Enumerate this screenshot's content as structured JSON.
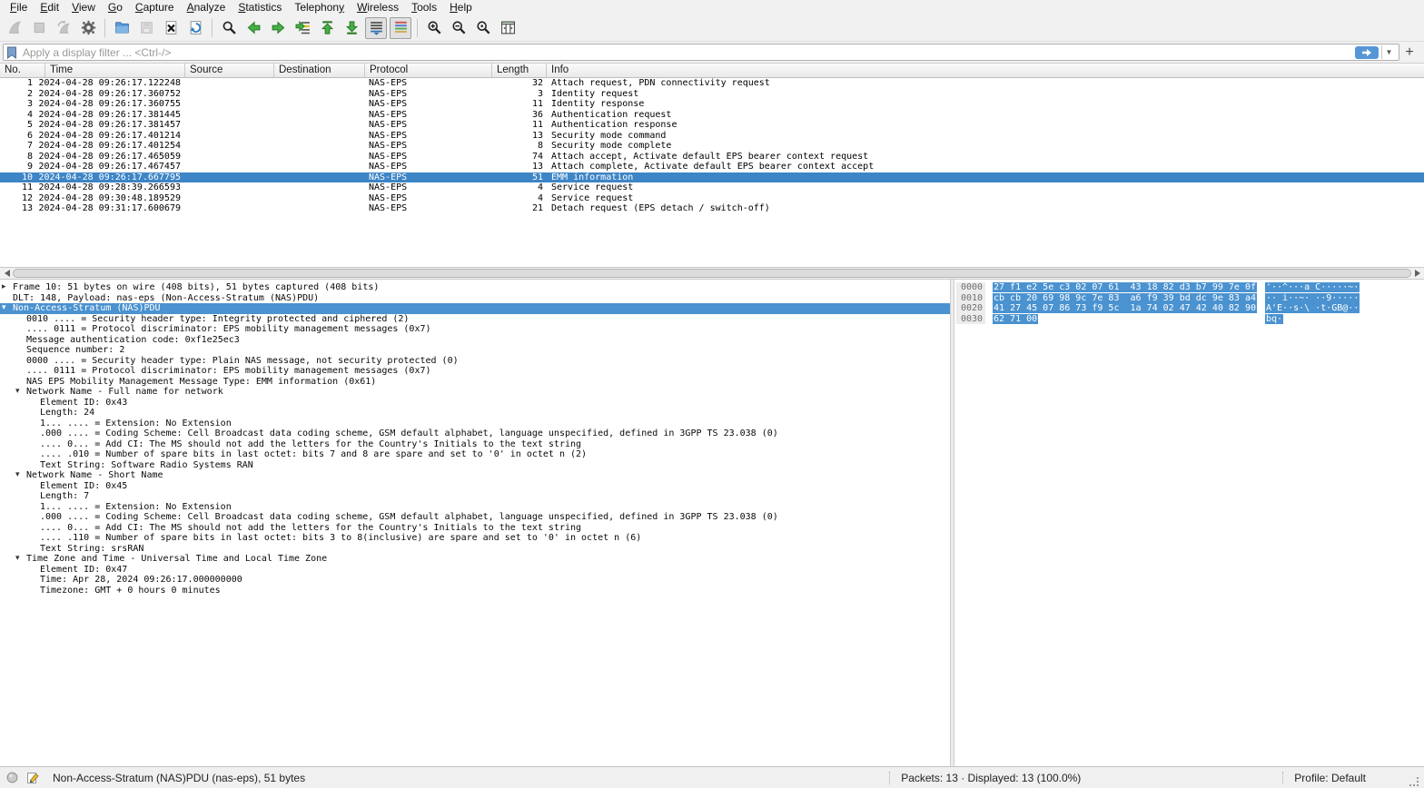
{
  "colors": {
    "sel_list": "#3d85c6",
    "sel_detail": "#4a92d0",
    "toolbar_green": "#45b045",
    "folder_blue": "#5e9cd8",
    "filter_apply_blue": "#5796d6"
  },
  "menu": {
    "items": [
      {
        "label": "File",
        "underline": 0
      },
      {
        "label": "Edit",
        "underline": 0
      },
      {
        "label": "View",
        "underline": 0
      },
      {
        "label": "Go",
        "underline": 0
      },
      {
        "label": "Capture",
        "underline": 0
      },
      {
        "label": "Analyze",
        "underline": 0
      },
      {
        "label": "Statistics",
        "underline": 0
      },
      {
        "label": "Telephony",
        "underline": 8
      },
      {
        "label": "Wireless",
        "underline": 0
      },
      {
        "label": "Tools",
        "underline": 0
      },
      {
        "label": "Help",
        "underline": 0
      }
    ]
  },
  "toolbar": {
    "buttons": [
      {
        "name": "start-capture",
        "icon": "fin",
        "state": "disabled"
      },
      {
        "name": "stop-capture",
        "icon": "stop",
        "state": "disabled"
      },
      {
        "name": "restart-capture",
        "icon": "fin-restart",
        "state": "disabled"
      },
      {
        "name": "capture-options",
        "icon": "gear",
        "state": "normal",
        "sep_after": true
      },
      {
        "name": "open-file",
        "icon": "folder",
        "state": "normal"
      },
      {
        "name": "save-file",
        "icon": "save",
        "state": "disabled"
      },
      {
        "name": "close-file",
        "icon": "close",
        "state": "normal"
      },
      {
        "name": "reload-file",
        "icon": "reload",
        "state": "normal",
        "sep_after": true
      },
      {
        "name": "find-packet",
        "icon": "find",
        "state": "normal"
      },
      {
        "name": "go-back",
        "icon": "arrow-left",
        "state": "normal"
      },
      {
        "name": "go-forward",
        "icon": "arrow-right",
        "state": "normal"
      },
      {
        "name": "go-to-packet",
        "icon": "goto",
        "state": "normal"
      },
      {
        "name": "go-first",
        "icon": "arrow-top",
        "state": "normal"
      },
      {
        "name": "go-last",
        "icon": "arrow-bottom",
        "state": "normal"
      },
      {
        "name": "auto-scroll",
        "icon": "autoscroll",
        "state": "pressed"
      },
      {
        "name": "colorize",
        "icon": "colorize",
        "state": "pressed",
        "sep_after": true
      },
      {
        "name": "zoom-in",
        "icon": "zoom-in",
        "state": "normal"
      },
      {
        "name": "zoom-out",
        "icon": "zoom-out",
        "state": "normal"
      },
      {
        "name": "zoom-original",
        "icon": "zoom-orig",
        "state": "normal"
      },
      {
        "name": "resize-columns",
        "icon": "resize-cols",
        "state": "normal"
      }
    ]
  },
  "filter": {
    "placeholder": "Apply a display filter ... <Ctrl-/>",
    "add_button": "+"
  },
  "packet_list": {
    "columns": [
      "No.",
      "Time",
      "Source",
      "Destination",
      "Protocol",
      "Length",
      "Info"
    ],
    "selected_no": 10,
    "rows": [
      {
        "no": 1,
        "time": "2024-04-28 09:26:17.122248",
        "source": "",
        "destination": "",
        "protocol": "NAS-EPS",
        "length": 32,
        "info": "Attach request, PDN connectivity request"
      },
      {
        "no": 2,
        "time": "2024-04-28 09:26:17.360752",
        "source": "",
        "destination": "",
        "protocol": "NAS-EPS",
        "length": 3,
        "info": "Identity request"
      },
      {
        "no": 3,
        "time": "2024-04-28 09:26:17.360755",
        "source": "",
        "destination": "",
        "protocol": "NAS-EPS",
        "length": 11,
        "info": "Identity response"
      },
      {
        "no": 4,
        "time": "2024-04-28 09:26:17.381445",
        "source": "",
        "destination": "",
        "protocol": "NAS-EPS",
        "length": 36,
        "info": "Authentication request"
      },
      {
        "no": 5,
        "time": "2024-04-28 09:26:17.381457",
        "source": "",
        "destination": "",
        "protocol": "NAS-EPS",
        "length": 11,
        "info": "Authentication response"
      },
      {
        "no": 6,
        "time": "2024-04-28 09:26:17.401214",
        "source": "",
        "destination": "",
        "protocol": "NAS-EPS",
        "length": 13,
        "info": "Security mode command"
      },
      {
        "no": 7,
        "time": "2024-04-28 09:26:17.401254",
        "source": "",
        "destination": "",
        "protocol": "NAS-EPS",
        "length": 8,
        "info": "Security mode complete"
      },
      {
        "no": 8,
        "time": "2024-04-28 09:26:17.465059",
        "source": "",
        "destination": "",
        "protocol": "NAS-EPS",
        "length": 74,
        "info": "Attach accept, Activate default EPS bearer context request"
      },
      {
        "no": 9,
        "time": "2024-04-28 09:26:17.467457",
        "source": "",
        "destination": "",
        "protocol": "NAS-EPS",
        "length": 13,
        "info": "Attach complete, Activate default EPS bearer context accept"
      },
      {
        "no": 10,
        "time": "2024-04-28 09:26:17.667795",
        "source": "",
        "destination": "",
        "protocol": "NAS-EPS",
        "length": 51,
        "info": "EMM information"
      },
      {
        "no": 11,
        "time": "2024-04-28 09:28:39.266593",
        "source": "",
        "destination": "",
        "protocol": "NAS-EPS",
        "length": 4,
        "info": "Service request"
      },
      {
        "no": 12,
        "time": "2024-04-28 09:30:48.189529",
        "source": "",
        "destination": "",
        "protocol": "NAS-EPS",
        "length": 4,
        "info": "Service request"
      },
      {
        "no": 13,
        "time": "2024-04-28 09:31:17.600679",
        "source": "",
        "destination": "",
        "protocol": "NAS-EPS",
        "length": 21,
        "info": "Detach request (EPS detach / switch-off)"
      }
    ]
  },
  "details": {
    "lines": [
      {
        "indent": 0,
        "arrow": "closed",
        "text": "Frame 10: 51 bytes on wire (408 bits), 51 bytes captured (408 bits)"
      },
      {
        "indent": 0,
        "arrow": null,
        "text": "DLT: 148, Payload: nas-eps (Non-Access-Stratum (NAS)PDU)"
      },
      {
        "indent": 0,
        "arrow": "open",
        "text": "Non-Access-Stratum (NAS)PDU",
        "selected": true
      },
      {
        "indent": 1,
        "arrow": null,
        "text": "0010 .... = Security header type: Integrity protected and ciphered (2)"
      },
      {
        "indent": 1,
        "arrow": null,
        "text": ".... 0111 = Protocol discriminator: EPS mobility management messages (0x7)"
      },
      {
        "indent": 1,
        "arrow": null,
        "text": "Message authentication code: 0xf1e25ec3"
      },
      {
        "indent": 1,
        "arrow": null,
        "text": "Sequence number: 2"
      },
      {
        "indent": 1,
        "arrow": null,
        "text": "0000 .... = Security header type: Plain NAS message, not security protected (0)"
      },
      {
        "indent": 1,
        "arrow": null,
        "text": ".... 0111 = Protocol discriminator: EPS mobility management messages (0x7)"
      },
      {
        "indent": 1,
        "arrow": null,
        "text": "NAS EPS Mobility Management Message Type: EMM information (0x61)"
      },
      {
        "indent": 1,
        "arrow": "open",
        "text": "Network Name - Full name for network"
      },
      {
        "indent": 2,
        "arrow": null,
        "text": "Element ID: 0x43"
      },
      {
        "indent": 2,
        "arrow": null,
        "text": "Length: 24"
      },
      {
        "indent": 2,
        "arrow": null,
        "text": "1... .... = Extension: No Extension"
      },
      {
        "indent": 2,
        "arrow": null,
        "text": ".000 .... = Coding Scheme: Cell Broadcast data coding scheme, GSM default alphabet, language unspecified, defined in 3GPP TS 23.038 (0)"
      },
      {
        "indent": 2,
        "arrow": null,
        "text": ".... 0... = Add CI: The MS should not add the letters for the Country's Initials to the text string"
      },
      {
        "indent": 2,
        "arrow": null,
        "text": ".... .010 = Number of spare bits in last octet: bits 7 and 8 are spare and set to '0' in octet n (2)"
      },
      {
        "indent": 2,
        "arrow": null,
        "text": "Text String: Software Radio Systems RAN"
      },
      {
        "indent": 1,
        "arrow": "open",
        "text": "Network Name - Short Name"
      },
      {
        "indent": 2,
        "arrow": null,
        "text": "Element ID: 0x45"
      },
      {
        "indent": 2,
        "arrow": null,
        "text": "Length: 7"
      },
      {
        "indent": 2,
        "arrow": null,
        "text": "1... .... = Extension: No Extension"
      },
      {
        "indent": 2,
        "arrow": null,
        "text": ".000 .... = Coding Scheme: Cell Broadcast data coding scheme, GSM default alphabet, language unspecified, defined in 3GPP TS 23.038 (0)"
      },
      {
        "indent": 2,
        "arrow": null,
        "text": ".... 0... = Add CI: The MS should not add the letters for the Country's Initials to the text string"
      },
      {
        "indent": 2,
        "arrow": null,
        "text": ".... .110 = Number of spare bits in last octet: bits 3 to 8(inclusive) are spare and set to '0' in octet n (6)"
      },
      {
        "indent": 2,
        "arrow": null,
        "text": "Text String: srsRAN"
      },
      {
        "indent": 1,
        "arrow": "open",
        "text": "Time Zone and Time - Universal Time and Local Time Zone"
      },
      {
        "indent": 2,
        "arrow": null,
        "text": "Element ID: 0x47"
      },
      {
        "indent": 2,
        "arrow": null,
        "text": "Time: Apr 28, 2024 09:26:17.000000000"
      },
      {
        "indent": 2,
        "arrow": null,
        "text": "Timezone: GMT + 0 hours 0 minutes"
      }
    ]
  },
  "hex": {
    "rows": [
      {
        "offset": "0000",
        "bytes": "27 f1 e2 5e c3 02 07 61  43 18 82 d3 b7 99 7e 0f",
        "ascii": "'··^···a C·····~·"
      },
      {
        "offset": "0010",
        "bytes": "cb cb 20 69 98 9c 7e 83  a6 f9 39 bd dc 9e 83 a4",
        "ascii": "·· i··~· ··9·····"
      },
      {
        "offset": "0020",
        "bytes": "41 27 45 07 86 73 f9 5c  1a 74 02 47 42 40 82 90",
        "ascii": "A'E··s·\\ ·t·GB@··"
      },
      {
        "offset": "0030",
        "bytes": "62 71 00",
        "ascii": "bq·"
      }
    ]
  },
  "status": {
    "left_text": "Non-Access-Stratum (NAS)PDU (nas-eps), 51 bytes",
    "packets_text": "Packets: 13 · Displayed: 13 (100.0%)",
    "profile_text": "Profile: Default"
  }
}
